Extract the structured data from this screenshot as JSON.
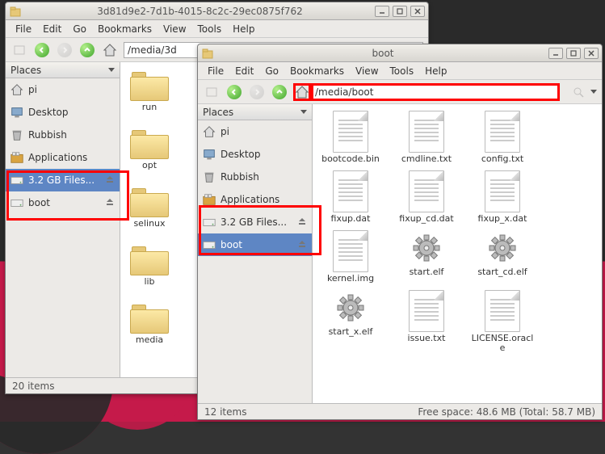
{
  "win1": {
    "title": "3d81d9e2-7d1b-4015-8c2c-29ec0875f762",
    "menu": [
      "File",
      "Edit",
      "Go",
      "Bookmarks",
      "View",
      "Tools",
      "Help"
    ],
    "path": "/media/3d",
    "places_header": "Places",
    "places": [
      {
        "label": "pi",
        "icon": "home"
      },
      {
        "label": "Desktop",
        "icon": "desktop"
      },
      {
        "label": "Rubbish",
        "icon": "trash"
      },
      {
        "label": "Applications",
        "icon": "apps"
      },
      {
        "label": "3.2 GB Files...",
        "icon": "drive",
        "eject": true,
        "selected": true
      },
      {
        "label": "boot",
        "icon": "drive",
        "eject": true
      }
    ],
    "folders": [
      "run",
      "opt",
      "selinux",
      "lib",
      "media"
    ],
    "status": "20 items"
  },
  "win2": {
    "title": "boot",
    "menu": [
      "File",
      "Edit",
      "Go",
      "Bookmarks",
      "View",
      "Tools",
      "Help"
    ],
    "path": "/media/boot",
    "places_header": "Places",
    "places": [
      {
        "label": "pi",
        "icon": "home"
      },
      {
        "label": "Desktop",
        "icon": "desktop"
      },
      {
        "label": "Rubbish",
        "icon": "trash"
      },
      {
        "label": "Applications",
        "icon": "apps"
      },
      {
        "label": "3.2 GB Files...",
        "icon": "drive",
        "eject": true
      },
      {
        "label": "boot",
        "icon": "drive",
        "eject": true,
        "selected": true
      }
    ],
    "files": [
      {
        "label": "bootcode.bin",
        "type": "doc"
      },
      {
        "label": "cmdline.txt",
        "type": "doc"
      },
      {
        "label": "config.txt",
        "type": "doc"
      },
      {
        "label": "fixup.dat",
        "type": "doc"
      },
      {
        "label": "fixup_cd.dat",
        "type": "doc"
      },
      {
        "label": "fixup_x.dat",
        "type": "doc"
      },
      {
        "label": "kernel.img",
        "type": "doc"
      },
      {
        "label": "start.elf",
        "type": "gear"
      },
      {
        "label": "start_cd.elf",
        "type": "gear"
      },
      {
        "label": "start_x.elf",
        "type": "gear"
      },
      {
        "label": "issue.txt",
        "type": "doc"
      },
      {
        "label": "LICENSE.oracle",
        "type": "doc"
      }
    ],
    "status_left": "12 items",
    "status_right": "Free space: 48.6 MB (Total: 58.7 MB)"
  }
}
